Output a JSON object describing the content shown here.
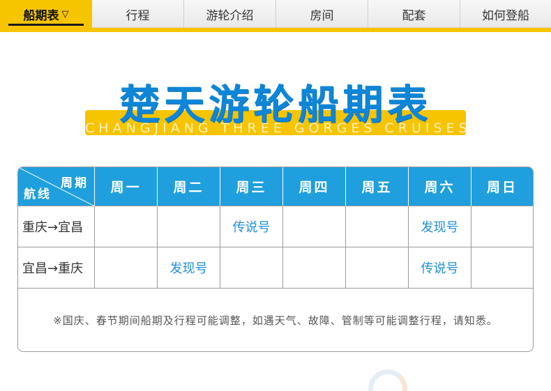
{
  "nav": {
    "active_tab": "船期表",
    "active_arrow": "▽",
    "tabs": [
      "行程",
      "游轮介绍",
      "房间",
      "配套",
      "如何登船"
    ]
  },
  "title": {
    "main": "楚天游轮船期表",
    "subtitle": "CHANGJIANG THREE GORGES CRUISES"
  },
  "table": {
    "corner_top": "周期",
    "corner_bottom": "航线",
    "days": [
      "周一",
      "周二",
      "周三",
      "周四",
      "周五",
      "周六",
      "周日"
    ],
    "rows": [
      {
        "route": "重庆→宜昌",
        "cells": [
          "",
          "",
          "传说号",
          "",
          "",
          "发现号",
          ""
        ]
      },
      {
        "route": "宜昌→重庆",
        "cells": [
          "",
          "发现号",
          "",
          "",
          "",
          "传说号",
          ""
        ]
      }
    ],
    "note": "※国庆、春节期间船期及行程可能调整，如遇天气、故障、管制等可能调整行程，请知悉。"
  },
  "colors": {
    "accent_yellow": "#f7c400",
    "header_blue": "#1f9fde",
    "title_blue": "#0d86d8",
    "ship_text": "#1f8fd6"
  }
}
